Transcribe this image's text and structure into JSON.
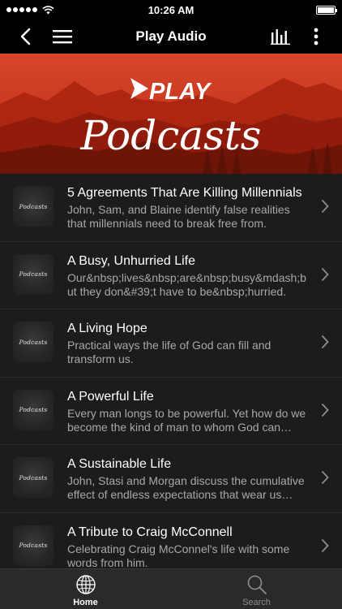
{
  "status": {
    "time": "10:26 AM"
  },
  "nav": {
    "title": "Play Audio"
  },
  "banner": {
    "brand": "PLAY",
    "headline": "Podcasts"
  },
  "thumb_label": "Podcasts",
  "items": [
    {
      "title": "5 Agreements That Are Killing Millennials",
      "desc": "John, Sam, and Blaine identify false realities that millennials need to break free from."
    },
    {
      "title": "A Busy, Unhurried Life",
      "desc": "Our&nbsp;lives&nbsp;are&nbsp;busy&mdash;but they don&#39;t have to be&nbsp;hurried."
    },
    {
      "title": "A Living Hope",
      "desc": "Practical ways the life of God can fill and transform us."
    },
    {
      "title": "A Powerful Life",
      "desc": "Every man longs to be powerful. Yet how do we become the kind of man to whom God can entrust power?"
    },
    {
      "title": "A Sustainable Life",
      "desc": "John, Stasi and Morgan discuss the cumulative effect of endless expectations that wear us down."
    },
    {
      "title": "A Tribute to Craig McConnell",
      "desc": "Celebrating Craig McConnel's life with some words from him."
    }
  ],
  "tabs": [
    {
      "label": "Home",
      "icon": "globe-icon",
      "active": true
    },
    {
      "label": "Search",
      "icon": "search-icon",
      "active": false
    }
  ],
  "colors": {
    "banner": "#c8331c",
    "background": "#1c1c1c",
    "tab_active": "#ffffff",
    "tab_inactive": "#8e8e8e"
  }
}
